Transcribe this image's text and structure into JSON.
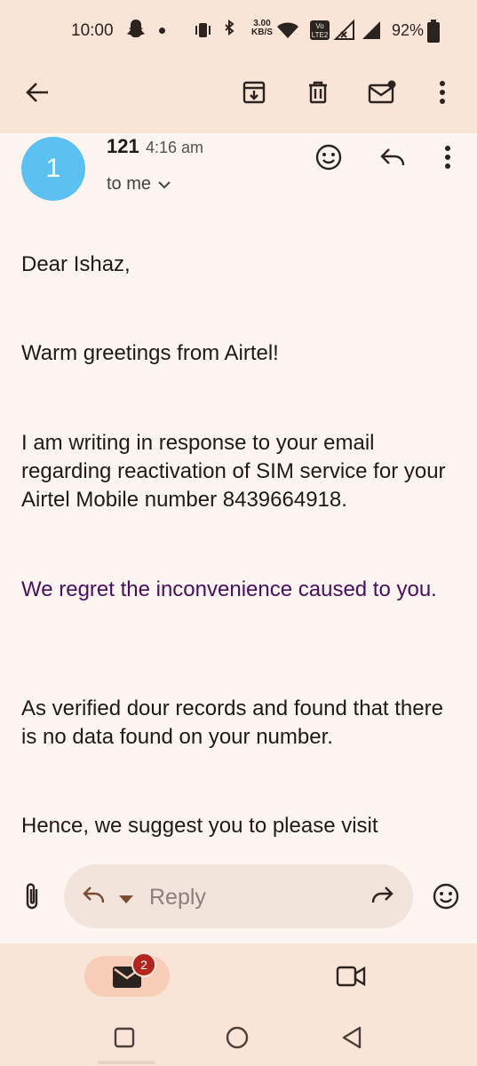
{
  "status_bar": {
    "time": "10:00",
    "net_speed_value": "3.00",
    "net_speed_unit": "KB/S",
    "battery_percent": "92%"
  },
  "app_bar": {
    "back": "back-arrow-icon",
    "actions": [
      "archive-icon",
      "delete-icon",
      "mark-unread-icon",
      "more-vert-icon"
    ]
  },
  "message": {
    "avatar_initial": "1",
    "sender": "121",
    "time": "4:16 am",
    "recipient": "to me",
    "paragraphs": {
      "greeting": "Dear Ishaz,",
      "intro": "Warm greetings from Airtel!",
      "response": "I am writing in response to your email regarding reactivation of SIM service for your Airtel Mobile number 8439664918.",
      "regret": "We regret the inconvenience caused to you.",
      "verified": "As verified dour records and found that there is no data found on your number.",
      "suggest": "Hence, we suggest you to please visit"
    }
  },
  "reply_bar": {
    "reply_label": "Reply"
  },
  "bottom_nav": {
    "mail_badge": "2"
  },
  "colors": {
    "header_bg": "#f9e4d8",
    "page_bg": "#fdf5f1",
    "avatar": "#5cc0f0",
    "purple_text": "#4b0d5e",
    "badge": "#b3261e"
  }
}
